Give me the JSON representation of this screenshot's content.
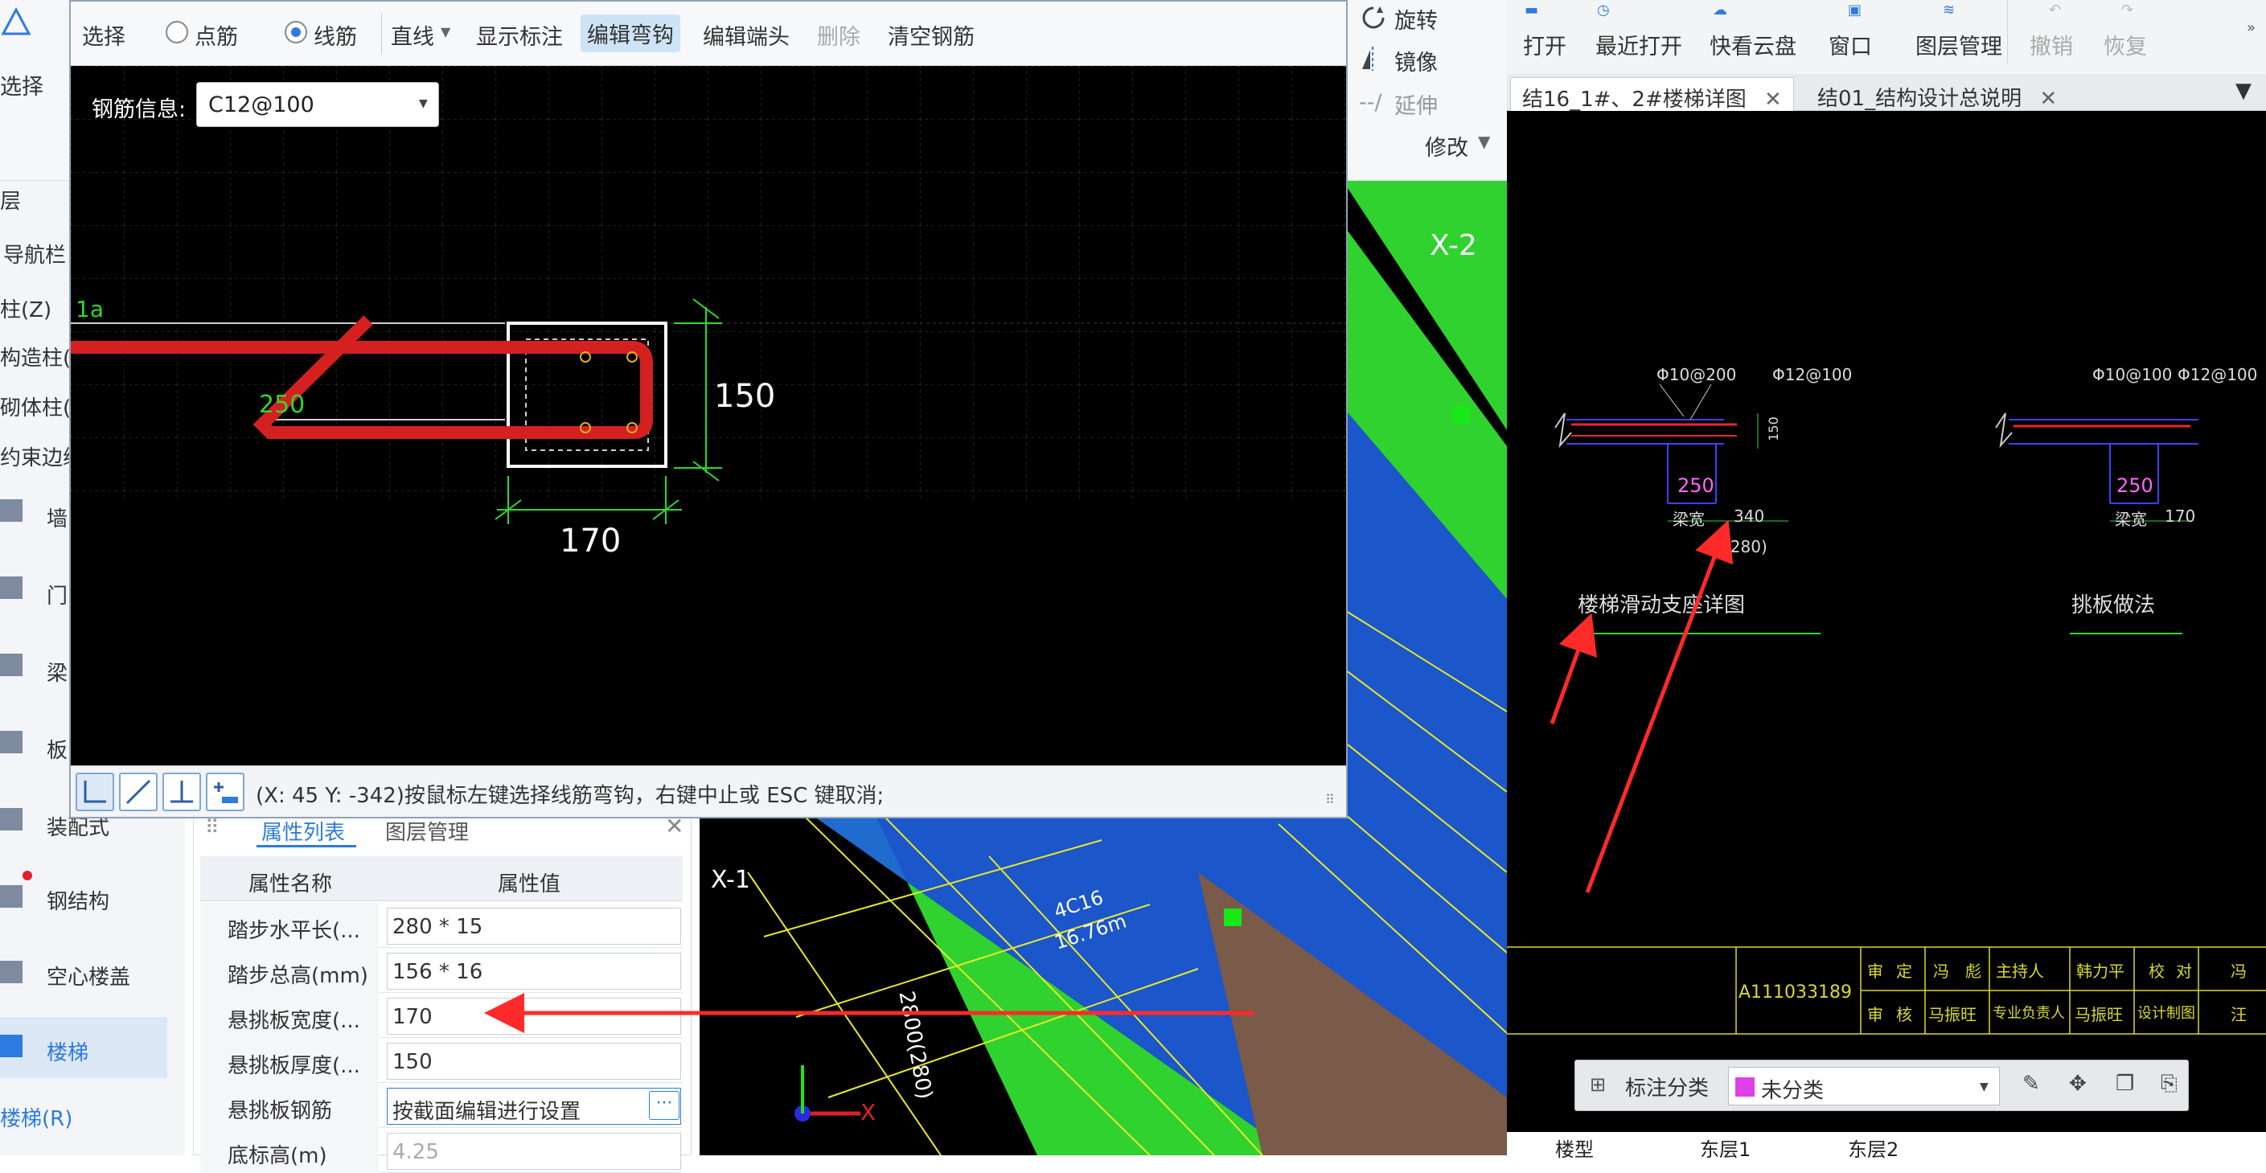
{
  "ribbon": {
    "select_label": "选择",
    "rotate_label": "旋转",
    "mirror_label": "镜像",
    "extend_label": "延伸",
    "modify_label": "修改"
  },
  "leftnav": {
    "layer_label": "层",
    "navbar_label": "导航栏",
    "items": [
      {
        "label": "柱(Z)"
      },
      {
        "label": "构造柱("
      },
      {
        "label": "砌体柱("
      },
      {
        "label": "约束边缘"
      },
      {
        "label": "墙"
      },
      {
        "label": "门"
      },
      {
        "label": "梁"
      },
      {
        "label": "板"
      },
      {
        "label": "装配式"
      },
      {
        "label": "钢结构"
      },
      {
        "label": "空心楼盖"
      },
      {
        "label": "楼梯"
      },
      {
        "label": "楼梯(R)"
      }
    ]
  },
  "dialog": {
    "toolbar": {
      "select": "选择",
      "point_rebar": "点筋",
      "line_rebar": "线筋",
      "line_type": "直线",
      "show_mark": "显示标注",
      "edit_hook": "编辑弯钩",
      "edit_end": "编辑端头",
      "delete": "删除",
      "clear_rebar": "清空钢筋"
    },
    "rebar_info_label": "钢筋信息:",
    "rebar_info_value": "C12@100",
    "cad": {
      "label_1a": "1a",
      "label_250": "250",
      "dim_150": "150",
      "dim_170": "170"
    },
    "status_text": "(X: 45 Y: -342)按鼠标左键选择线筋弯钩，右键中止或 ESC 键取消;"
  },
  "properties": {
    "tabs": [
      "属性列表",
      "图层管理"
    ],
    "header": {
      "name": "属性名称",
      "value": "属性值"
    },
    "rows": [
      {
        "name": "踏步水平长(...",
        "value": "280 * 15"
      },
      {
        "name": "踏步总高(mm)",
        "value": "156 * 16"
      },
      {
        "name": "悬挑板宽度(...",
        "value": "170"
      },
      {
        "name": "悬挑板厚度(...",
        "value": "150"
      },
      {
        "name": "悬挑板钢筋",
        "value": "按截面编辑进行设置"
      },
      {
        "name": "底标高(m)",
        "value": "4.25"
      }
    ]
  },
  "model_view": {
    "axis_x2": "X-2",
    "axis_x1": "X-1",
    "rebar_note_1": "4C16",
    "rebar_note_2": "16.76m",
    "dim_text": "2800(280)",
    "axis_x": "X"
  },
  "docviewer": {
    "toolbar": [
      "打开",
      "最近打开",
      "快看云盘",
      "窗口",
      "图层管理",
      "撤销",
      "恢复"
    ],
    "tabs": [
      "结16_1#、2#楼梯详图",
      "结01_结构设计总说明"
    ],
    "drawing": {
      "left": {
        "rebar1": "Φ10@200",
        "rebar2": "Φ12@100",
        "width": "250",
        "dim1": "梁宽",
        "dim2": "340",
        "dim3": "(280)",
        "title": "楼梯滑动支座详图",
        "thick": "150"
      },
      "right": {
        "rebar1": "Φ10@100",
        "rebar2": "Φ12@100",
        "width": "250",
        "dim1": "梁宽",
        "dim2": "170",
        "title": "挑板做法"
      }
    },
    "titleblock": {
      "code": "A111033189",
      "cells_top": [
        "审",
        "定",
        "冯",
        "彪",
        "主持人",
        "韩力平",
        "校",
        "对",
        "冯"
      ],
      "cells_bottom": [
        "审",
        "核",
        "马振旺",
        "专业负责人",
        "马振旺",
        "设计制图",
        "汪"
      ]
    },
    "mark_tool": {
      "label": "标注分类",
      "value": "未分类"
    },
    "bottom_tabs": [
      "楼型",
      "东层1",
      "东层2"
    ]
  },
  "colors": {
    "cad_bg": "#000000",
    "rebar_red": "#d42020",
    "dim_green": "#2ed82e",
    "highlight_blue": "#cfe3f6",
    "arrow_red": "#ff2a2a"
  }
}
